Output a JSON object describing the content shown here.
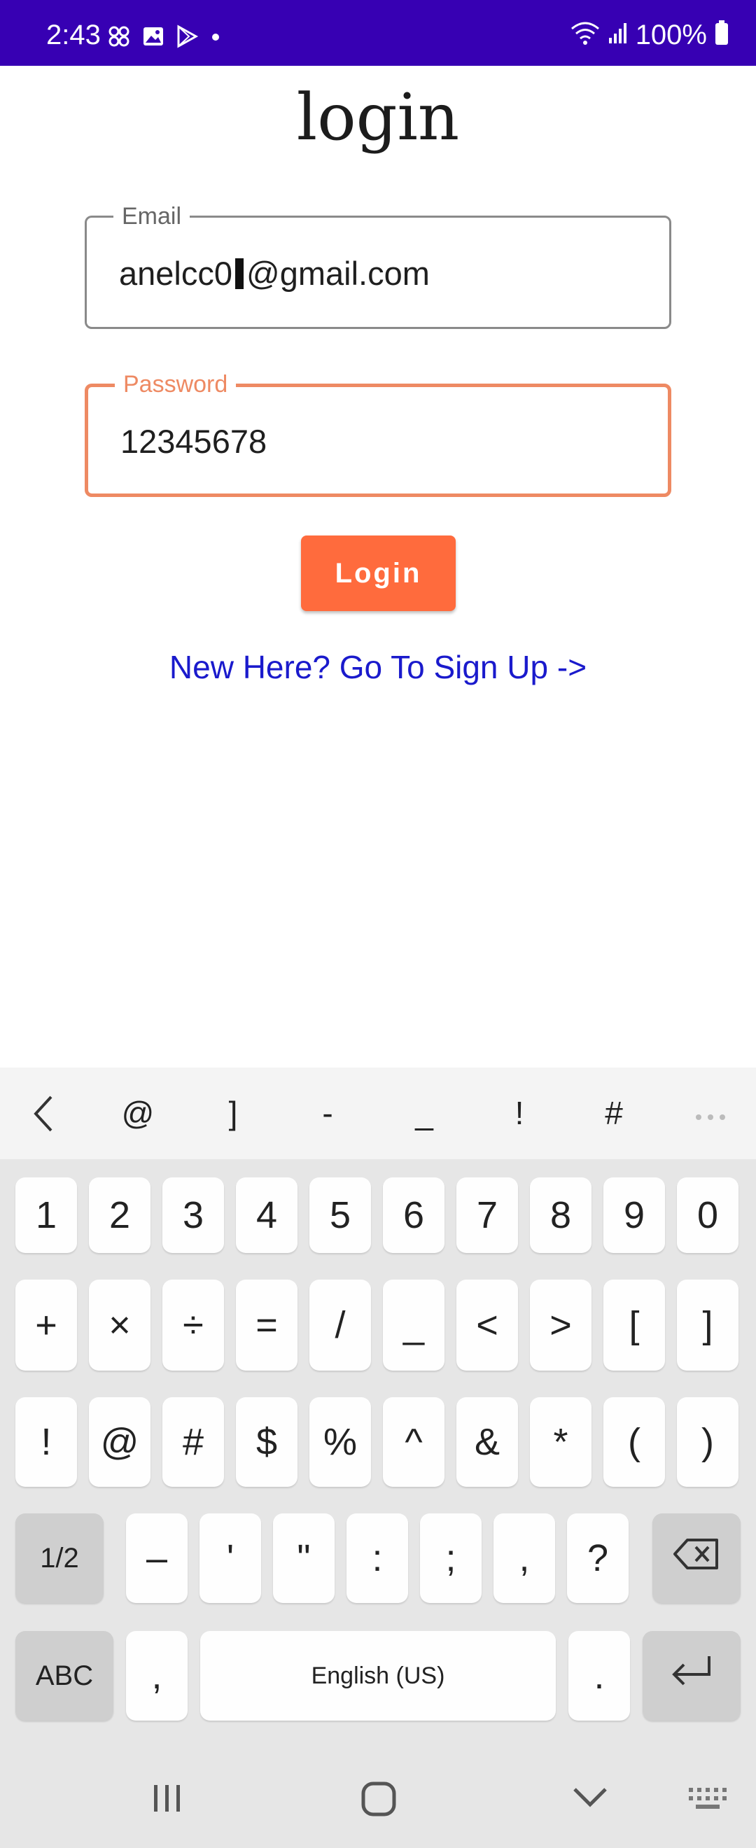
{
  "status_bar": {
    "time": "2:43",
    "battery": "100%",
    "background": "#3700b3"
  },
  "screen": {
    "title": "login",
    "email": {
      "label": "Email",
      "value_before_caret": "anelcc0",
      "value_after_caret": "@gmail.com"
    },
    "password": {
      "label": "Password",
      "value": "12345678"
    },
    "login_label": "Login",
    "signup_link": "New Here? Go To Sign Up ->",
    "accent": "#ff6b3d",
    "link_color": "#1a1acc"
  },
  "keyboard": {
    "suggestions": [
      "@",
      "]",
      "-",
      "_",
      "!",
      "#"
    ],
    "row1": [
      "1",
      "2",
      "3",
      "4",
      "5",
      "6",
      "7",
      "8",
      "9",
      "0"
    ],
    "row2": [
      "+",
      "×",
      "÷",
      "=",
      "/",
      "_",
      "<",
      ">",
      "[",
      "]"
    ],
    "row3": [
      "!",
      "@",
      "#",
      "$",
      "%",
      "^",
      "&",
      "*",
      "(",
      ")"
    ],
    "row4_toggle": "1/2",
    "row4": [
      "–",
      "'",
      "\"",
      ":",
      ";",
      ",",
      "?"
    ],
    "abc": "ABC",
    "comma": ",",
    "space": "English (US)",
    "period": "."
  }
}
